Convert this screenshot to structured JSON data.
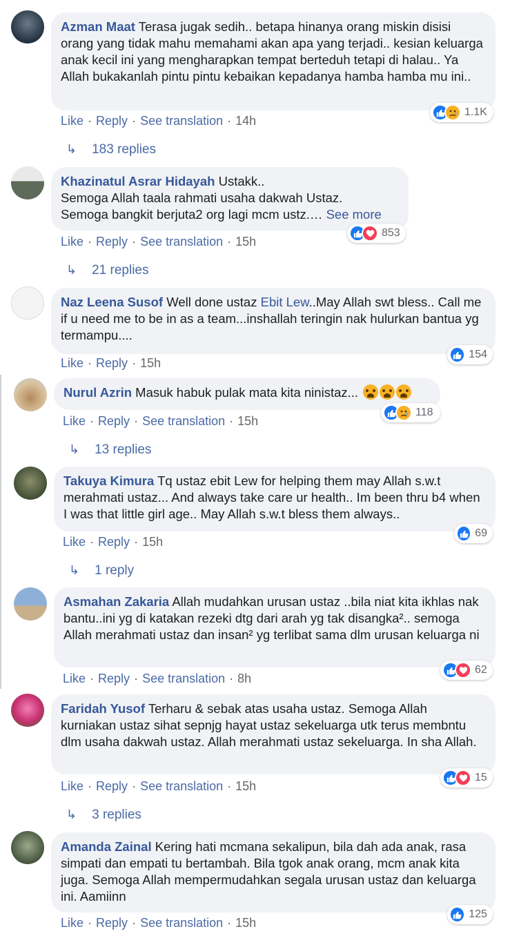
{
  "actions": {
    "like": "Like",
    "reply": "Reply",
    "see_translation": "See translation"
  },
  "comments": [
    {
      "author": "Azman Maat",
      "text": "Terasa jugak sedih.. betapa hinanya orang miskin disisi orang yang tidak mahu memahami akan apa yang terjadi.. kesian keluarga anak kecil ini yang mengharapkan tempat berteduh tetapi di halau.. Ya Allah bukakanlah pintu pintu kebaikan kepadanya hamba hamba mu ini..",
      "time": "14h",
      "reactions": "1.1K",
      "replies": "183 replies"
    },
    {
      "author": "Khazinatul Asrar Hidayah",
      "text": "Ustakk..",
      "text2": "Semoga Allah taala rahmati usaha dakwah Ustaz.",
      "text3": "Semoga bangkit berjuta2 org lagi mcm ustz.…",
      "see_more": "See more",
      "time": "15h",
      "reactions": "853",
      "replies": "21 replies"
    },
    {
      "author": "Naz Leena Susof",
      "text": "Well done ustaz",
      "mention": "Ebit Lew",
      "text_after": "..May Allah swt bless.. Call me if u need me to be in as a team...inshallah teringin nak hulurkan bantua yg termampu....",
      "time": "15h",
      "reactions": "154"
    },
    {
      "author": "Nurul Azrin",
      "text": "Masuk habuk pulak mata kita ninistaz...",
      "time": "15h",
      "reactions": "118",
      "replies": "13 replies"
    },
    {
      "author": "Takuya Kimura",
      "text": "Tq ustaz ebit Lew for helping them may Allah s.w.t merahmati ustaz... And always take care ur health.. Im been thru b4 when I was that little girl age.. May Allah s.w.t bless them always..",
      "time": "15h",
      "reactions": "69",
      "replies": "1 reply"
    },
    {
      "author": "Asmahan Zakaria",
      "text": "Allah mudahkan urusan ustaz ..bila niat kita ikhlas nak bantu..ini yg di katakan rezeki dtg dari arah yg tak disangka².. semoga Allah merahmati ustaz dan insan² yg terlibat sama dlm urusan keluarga ni",
      "time": "8h",
      "reactions": "62"
    },
    {
      "author": "Faridah Yusof",
      "text": "Terharu & sebak atas usaha ustaz. Semoga Allah kurniakan ustaz sihat sepnjg hayat ustaz sekeluarga utk terus membntu dlm usaha dakwah ustaz. Allah merahmati ustaz sekeluarga. In sha Allah.",
      "time": "15h",
      "reactions": "15",
      "replies": "3 replies"
    },
    {
      "author": "Amanda Zainal",
      "text": "Kering hati mcmana sekalipun, bila dah ada anak, rasa simpati dan empati tu bertambah. Bila tgok anak orang, mcm anak kita juga. Semoga Allah mempermudahkan segala urusan ustaz dan keluarga ini. Aamiinn",
      "time": "15h",
      "reactions": "125"
    }
  ],
  "colors": {
    "link": "#365899",
    "bubble": "#f0f2f5",
    "like": "#1877f2",
    "love": "#f33e58",
    "sad": "#f7b125"
  }
}
